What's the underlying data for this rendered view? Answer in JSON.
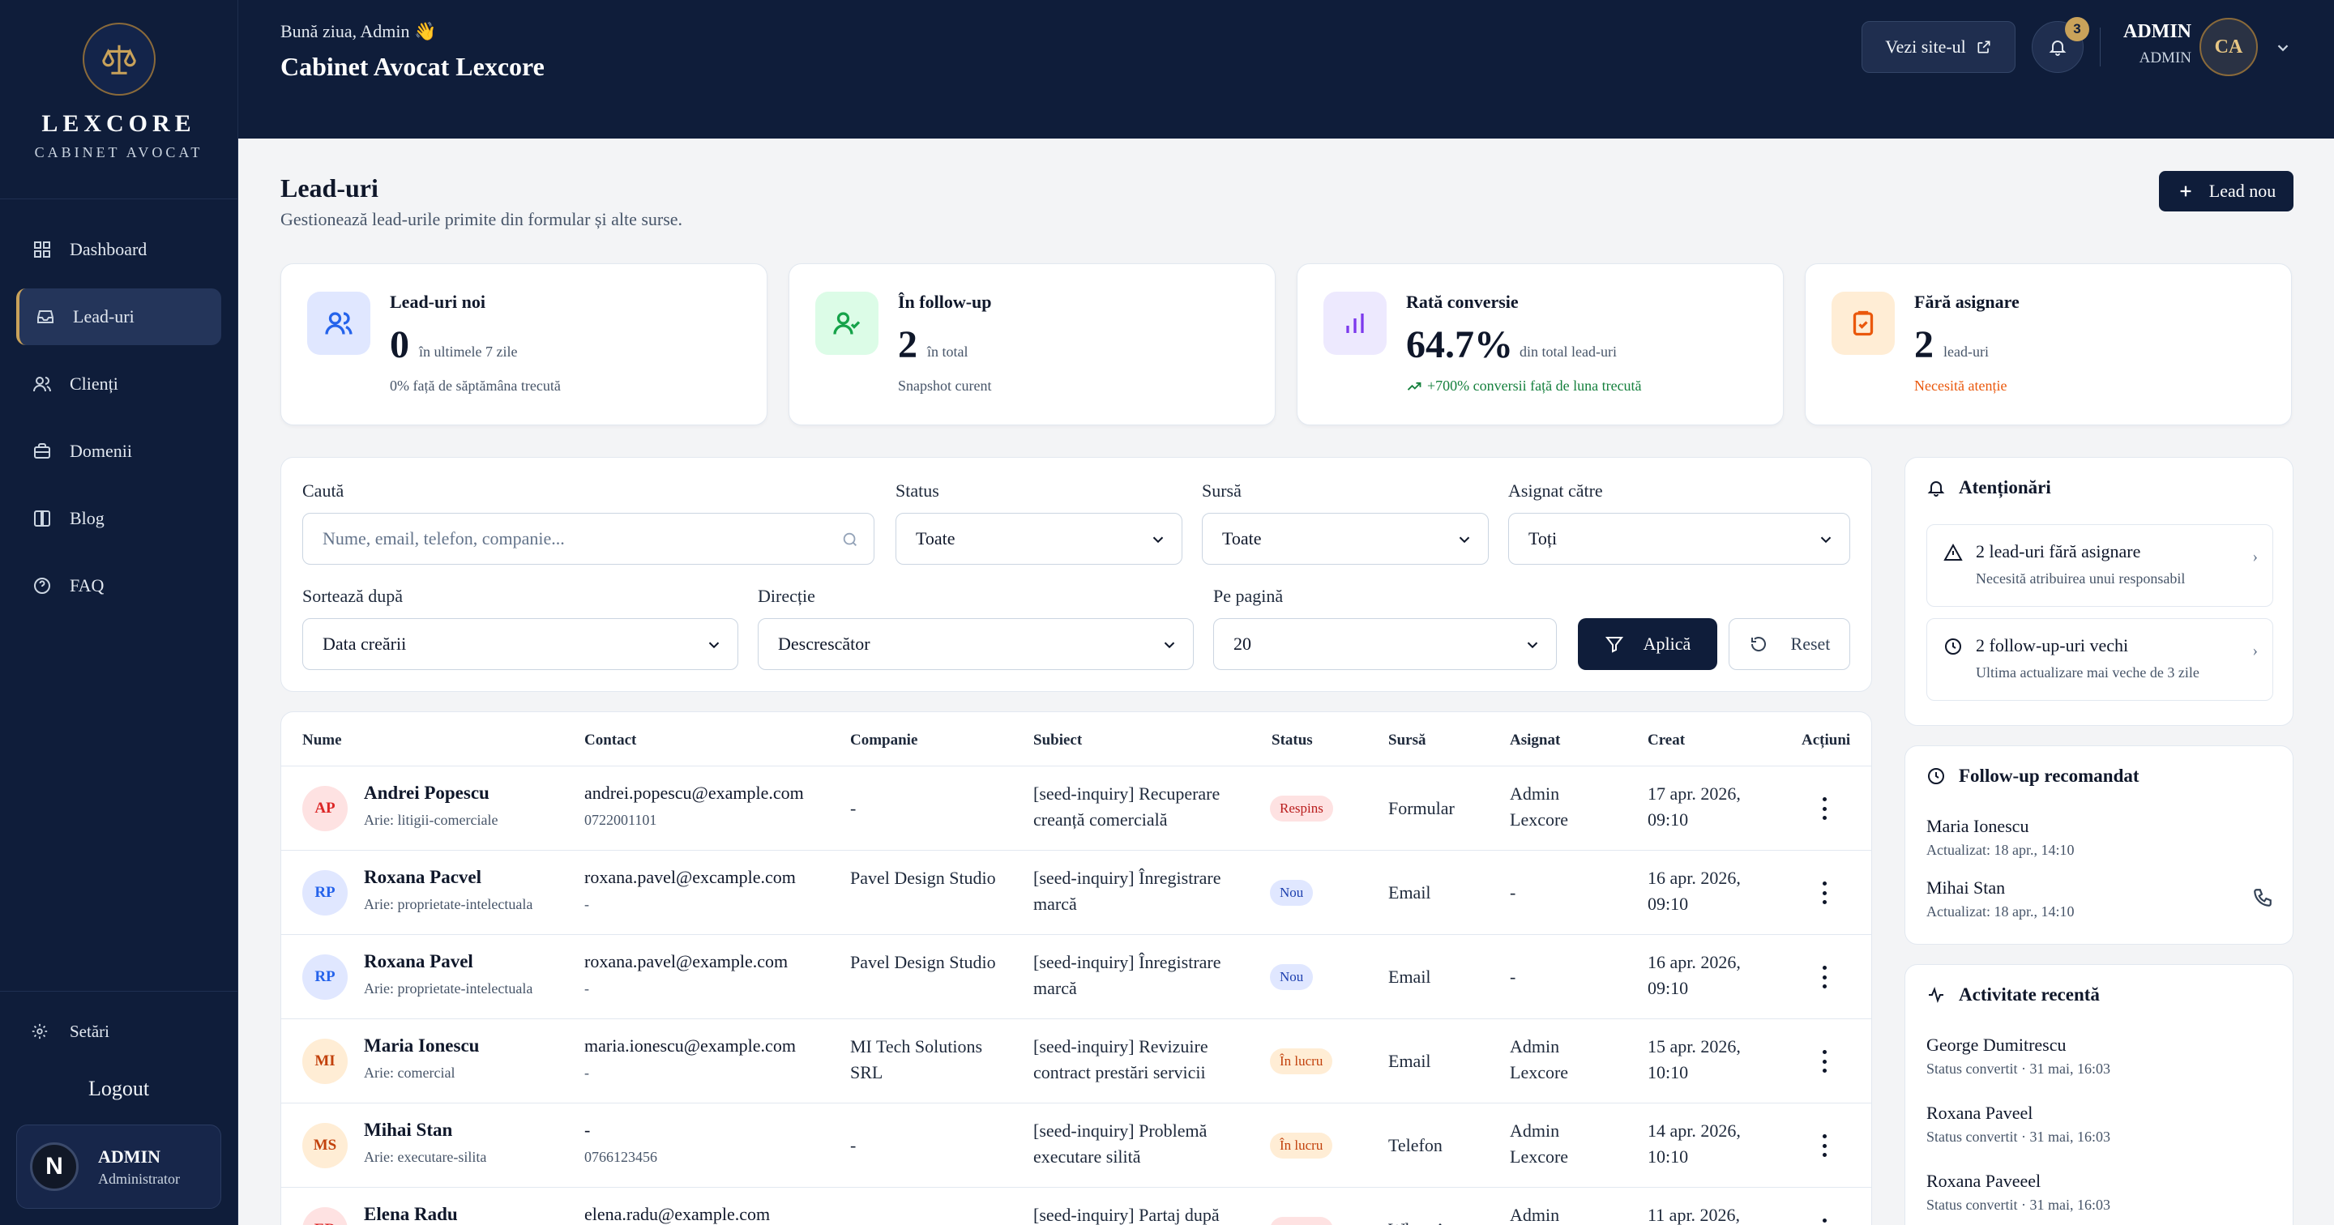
{
  "brand": {
    "name": "LEXCORE",
    "subtitle": "CABINET AVOCAT"
  },
  "nav": [
    {
      "label": "Dashboard",
      "icon": "dashboard-icon"
    },
    {
      "label": "Lead-uri",
      "icon": "inbox-icon",
      "active": true
    },
    {
      "label": "Clienți",
      "icon": "users-icon"
    },
    {
      "label": "Domenii",
      "icon": "briefcase-icon"
    },
    {
      "label": "Blog",
      "icon": "book-icon"
    },
    {
      "label": "FAQ",
      "icon": "help-icon"
    }
  ],
  "sidebar_bottom": {
    "settings": "Setări",
    "logout": "Logout",
    "user_initial": "N",
    "user_name": "ADMIN",
    "user_role": "Administrator"
  },
  "header": {
    "greeting": "Bună ziua, Admin 👋",
    "title": "Cabinet Avocat Lexcore",
    "view_site": "Vezi site-ul",
    "notifications": "3",
    "user_name": "ADMIN",
    "user_role": "ADMIN",
    "user_initials": "CA"
  },
  "page": {
    "title": "Lead-uri",
    "subtitle": "Gestionează lead-urile primite din formular și alte surse.",
    "new_button": "Lead nou"
  },
  "kpis": [
    {
      "title": "Lead-uri noi",
      "value": "0",
      "unit": "în ultimele 7 zile",
      "note": "0% față de săptămâna trecută",
      "color": "#2563eb"
    },
    {
      "title": "În follow-up",
      "value": "2",
      "unit": "în total",
      "note": "Snapshot curent",
      "color": "#16a34a"
    },
    {
      "title": "Rată conversie",
      "value": "64.7%",
      "unit": "din total lead-uri",
      "note": "+700% conversii față de luna trecută",
      "color": "#7c3aed"
    },
    {
      "title": "Fără asignare",
      "value": "2",
      "unit": "lead-uri",
      "note": "Necesită atenție",
      "color": "#ea580c"
    }
  ],
  "filters": {
    "search_label": "Caută",
    "search_placeholder": "Nume, email, telefon, companie...",
    "status_label": "Status",
    "status_value": "Toate",
    "source_label": "Sursă",
    "source_value": "Toate",
    "assigned_label": "Asignat către",
    "assigned_value": "Toți",
    "sort_label": "Sortează după",
    "sort_value": "Data creării",
    "direction_label": "Direcție",
    "direction_value": "Descrescător",
    "per_page_label": "Pe pagină",
    "per_page_value": "20",
    "apply": "Aplică",
    "reset": "Reset"
  },
  "table": {
    "headers": [
      "Nume",
      "Contact",
      "Companie",
      "Subiect",
      "Status",
      "Sursă",
      "Asignat",
      "Creat",
      "Acțiuni"
    ],
    "rows": [
      {
        "initials": "AP",
        "name": "Andrei Popescu",
        "area": "Arie: litigii-comerciale",
        "email": "andrei.popescu@example.com",
        "phone": "0722001101",
        "company": "-",
        "subject": "[seed-inquiry] Recuperare creanță comercială",
        "status": "Respins",
        "source": "Formular",
        "assigned": "Admin Lexcore",
        "created": "17 apr. 2026, 09:10"
      },
      {
        "initials": "RP",
        "name": "Roxana Pacvel",
        "area": "Arie: proprietate-intelectuala",
        "email": "roxana.pavel@excample.com",
        "phone": "-",
        "company": "Pavel Design Studio",
        "subject": "[seed-inquiry] Înregistrare marcă",
        "status": "Nou",
        "source": "Email",
        "assigned": "-",
        "created": "16 apr. 2026, 09:10"
      },
      {
        "initials": "RP",
        "name": "Roxana Pavel",
        "area": "Arie: proprietate-intelectuala",
        "email": "roxana.pavel@example.com",
        "phone": "-",
        "company": "Pavel Design Studio",
        "subject": "[seed-inquiry] Înregistrare marcă",
        "status": "Nou",
        "source": "Email",
        "assigned": "-",
        "created": "16 apr. 2026, 09:10"
      },
      {
        "initials": "MI",
        "name": "Maria Ionescu",
        "area": "Arie: comercial",
        "email": "maria.ionescu@example.com",
        "phone": "-",
        "company": "MI Tech Solutions SRL",
        "subject": "[seed-inquiry] Revizuire contract prestări servicii",
        "status": "În lucru",
        "source": "Email",
        "assigned": "Admin Lexcore",
        "created": "15 apr. 2026, 10:10"
      },
      {
        "initials": "MS",
        "name": "Mihai Stan",
        "area": "Arie: executare-silita",
        "email": "-",
        "phone": "0766123456",
        "company": "-",
        "subject": "[seed-inquiry] Problemă executare silită",
        "status": "În lucru",
        "source": "Telefon",
        "assigned": "Admin Lexcore",
        "created": "14 apr. 2026, 10:10"
      },
      {
        "initials": "ER",
        "name": "Elena Radu",
        "area": "",
        "email": "elena.radu@example.com",
        "phone": "",
        "company": "",
        "subject": "[seed-inquiry] Partaj după",
        "status": "Respins",
        "source": "WhatsApp",
        "assigned": "Admin",
        "created": "11 apr. 2026,"
      }
    ]
  },
  "alerts": {
    "title": "Atenționări",
    "items": [
      {
        "title": "2 lead-uri fără asignare",
        "sub": "Necesită atribuirea unui responsabil"
      },
      {
        "title": "2 follow-up-uri vechi",
        "sub": "Ultima actualizare mai veche de 3 zile"
      }
    ]
  },
  "followup": {
    "title": "Follow-up recomandat",
    "items": [
      {
        "name": "Maria Ionescu",
        "sub": "Actualizat: 18 apr., 14:10"
      },
      {
        "name": "Mihai Stan",
        "sub": "Actualizat: 18 apr., 14:10"
      }
    ]
  },
  "activity": {
    "title": "Activitate recentă",
    "items": [
      {
        "name": "George Dumitrescu",
        "sub": "Status convertit · 31 mai, 16:03"
      },
      {
        "name": "Roxana Paveel",
        "sub": "Status convertit · 31 mai, 16:03"
      },
      {
        "name": "Roxana Paveeel",
        "sub": "Status convertit · 31 mai, 16:03"
      }
    ]
  }
}
